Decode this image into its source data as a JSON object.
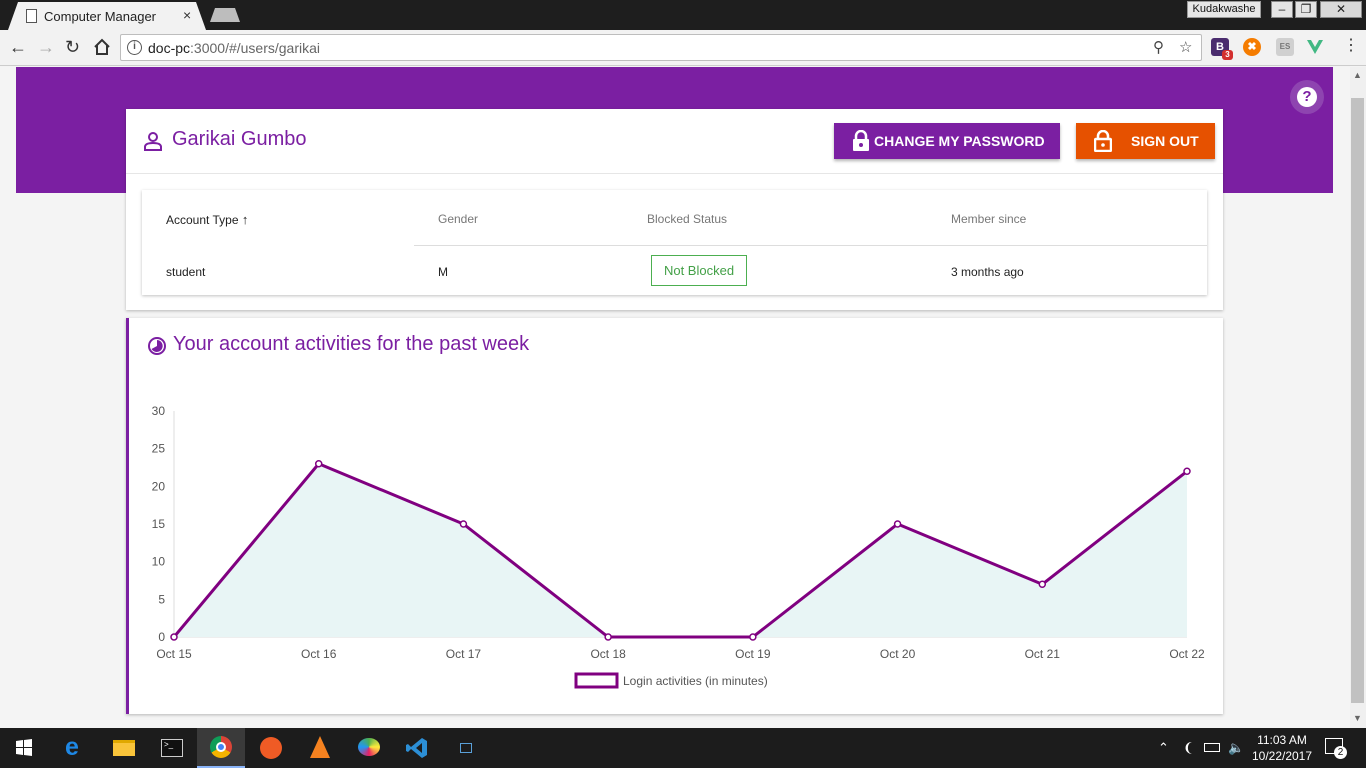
{
  "browser": {
    "tab_title": "Computer Manager",
    "tab_close": "×",
    "profile_name": "Kudakwashe",
    "url_host": "doc-pc",
    "url_path": ":3000/#/users/garikai",
    "minimize": "–",
    "restore": "❐",
    "close": "✕",
    "extension_badge": "3"
  },
  "header": {
    "user_name": "Garikai Gumbo",
    "change_password_label": "CHANGE MY PASSWORD",
    "sign_out_label": "SIGN OUT",
    "help_label": "?"
  },
  "account_table": {
    "columns": [
      "Account Type",
      "Gender",
      "Blocked Status",
      "Member since"
    ],
    "sort_arrow": "↑",
    "row": {
      "account_type": "student",
      "gender": "M",
      "blocked_status": "Not Blocked",
      "member_since": "3 months ago"
    }
  },
  "activities": {
    "title": "Your account activities for the past week"
  },
  "chart_data": {
    "type": "area",
    "categories": [
      "Oct 15",
      "Oct 16",
      "Oct 17",
      "Oct 18",
      "Oct 19",
      "Oct 20",
      "Oct 21",
      "Oct 22"
    ],
    "series": [
      {
        "name": "Login activities (in minutes)",
        "values": [
          0,
          23,
          15,
          0,
          0,
          15,
          7,
          22
        ]
      }
    ],
    "yticks": [
      0,
      5,
      10,
      15,
      20,
      25,
      30
    ],
    "ylim": [
      0,
      30
    ],
    "legend_position": "bottom",
    "line_color": "#800080",
    "fill_color": "#e8f5f5",
    "grid": false
  },
  "taskbar": {
    "time": "11:03 AM",
    "date": "10/22/2017",
    "notifications": "2"
  },
  "colors": {
    "primary": "#7b1fa2",
    "accent": "#e65100",
    "success": "#43a047"
  }
}
